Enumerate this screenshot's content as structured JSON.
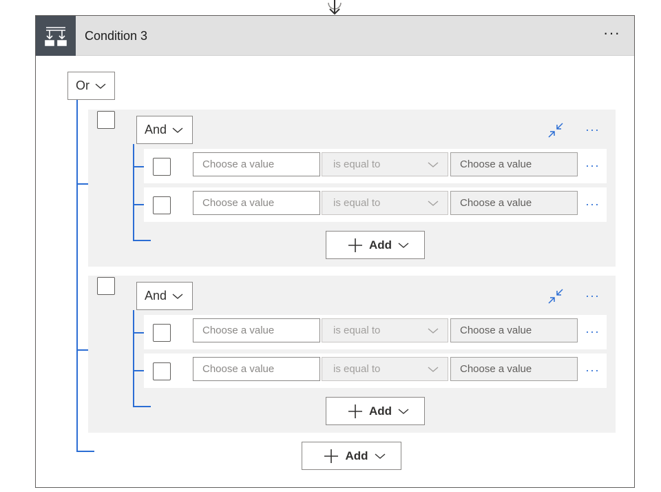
{
  "condition": {
    "title": "Condition 3",
    "more_label": "···",
    "or_label": "Or",
    "add_label": "Add"
  },
  "groups": [
    {
      "and_label": "And",
      "more_label": "···",
      "add_label": "Add",
      "rows": [
        {
          "left_placeholder": "Choose a value",
          "operator": "is equal to",
          "right_placeholder": "Choose a value",
          "more_label": "···"
        },
        {
          "left_placeholder": "Choose a value",
          "operator": "is equal to",
          "right_placeholder": "Choose a value",
          "more_label": "···"
        }
      ]
    },
    {
      "and_label": "And",
      "more_label": "···",
      "add_label": "Add",
      "rows": [
        {
          "left_placeholder": "Choose a value",
          "operator": "is equal to",
          "right_placeholder": "Choose a value",
          "more_label": "···"
        },
        {
          "left_placeholder": "Choose a value",
          "operator": "is equal to",
          "right_placeholder": "Choose a value",
          "more_label": "···"
        }
      ]
    }
  ],
  "colors": {
    "accent": "#2b6dd4",
    "header_bg": "#e1e1e1",
    "icon_bg": "#484f58",
    "group_bg": "#f1f1f1"
  },
  "icons": [
    "connector-arrow-icon",
    "condition-icon",
    "chevron-down-icon",
    "collapse-icon",
    "plus-icon",
    "more-icon"
  ]
}
